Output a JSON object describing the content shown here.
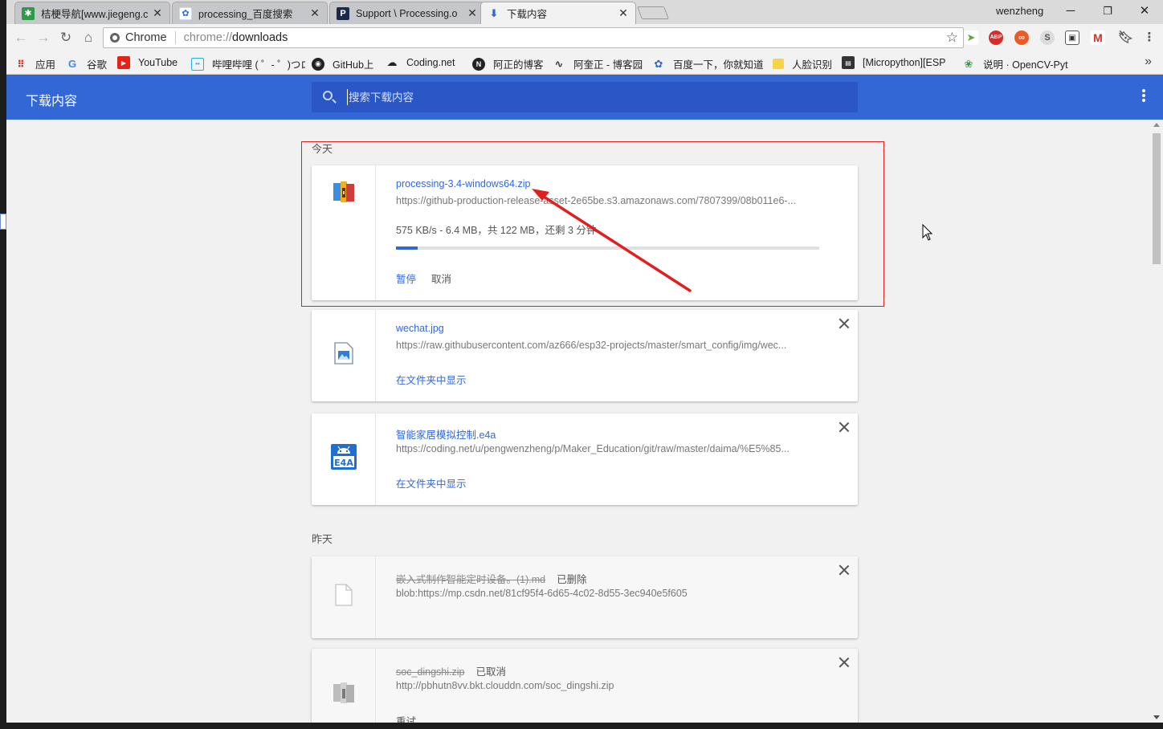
{
  "tabs": [
    {
      "title": "桔梗导航[www.jiegeng.c",
      "icon": "grid-icon",
      "color": "#2e9a4a"
    },
    {
      "title": "processing_百度搜索",
      "icon": "baidu-paw-icon",
      "color": "#2f66d8"
    },
    {
      "title": "Support \\ Processing.o",
      "icon": "processing-p-icon",
      "color": "#1c2a4a"
    },
    {
      "title": "下载内容",
      "icon": "download-icon",
      "color": "#3367d6"
    }
  ],
  "window": {
    "user": "wenzheng"
  },
  "omnibox": {
    "chip": "Chrome",
    "scheme": "chrome://",
    "path": "downloads"
  },
  "bookmarks": [
    {
      "label": "应用",
      "icon": "apps-icon"
    },
    {
      "label": "谷歌",
      "icon": "google-icon"
    },
    {
      "label": "YouTube",
      "icon": "youtube-icon"
    },
    {
      "label": "哔哩哔哩 ( ゜- ゜)つロ",
      "icon": "bilibili-icon"
    },
    {
      "label": "GitHub上",
      "icon": "github-icon"
    },
    {
      "label": "Coding.net",
      "icon": "coding-icon"
    },
    {
      "label": "阿正的博客",
      "icon": "blog-n-icon"
    },
    {
      "label": "阿奎正 - 博客园",
      "icon": "cnblogs-icon"
    },
    {
      "label": "百度一下，你就知道",
      "icon": "baidu-icon"
    },
    {
      "label": "人脸识别",
      "icon": "folder-icon"
    },
    {
      "label": "[Micropython][ESP",
      "icon": "micropython-icon"
    },
    {
      "label": "说明 · OpenCV-Pyt",
      "icon": "opencv-icon"
    }
  ],
  "header": {
    "title": "下载内容",
    "search_placeholder": "搜索下载内容"
  },
  "sections": {
    "today": "今天",
    "yesterday": "昨天"
  },
  "downloads": [
    {
      "name": "processing-3.4-windows64.zip",
      "url": "https://github-production-release-asset-2e65be.s3.amazonaws.com/7807399/08b011e6-...",
      "progress_text": "575 KB/s - 6.4 MB，共 122 MB，还剩 3 分钟",
      "progress": 0.052,
      "pause": "暂停",
      "cancel": "取消"
    },
    {
      "name": "wechat.jpg",
      "url": "https://raw.githubusercontent.com/az666/esp32-projects/master/smart_config/img/wec...",
      "show": "在文件夹中显示"
    },
    {
      "name": "智能家居模拟控制.e4a",
      "url": "https://coding.net/u/pengwenzheng/p/Maker_Education/git/raw/master/daima/%E5%85...",
      "show": "在文件夹中显示"
    },
    {
      "name": "嵌入式制作智能定时设备。(1).md",
      "status": "已删除",
      "url": "blob:https://mp.csdn.net/81cf95f4-6d65-4c02-8d55-3ec940e5f605"
    },
    {
      "name": "soc_dingshi.zip",
      "status": "已取消",
      "url": "http://pbhutn8vv.bkt.clouddn.com/soc_dingshi.zip",
      "retry": "重试"
    }
  ],
  "colors": {
    "accent": "#3367d6",
    "highlight": "#e02020",
    "header": "#3367d6"
  }
}
